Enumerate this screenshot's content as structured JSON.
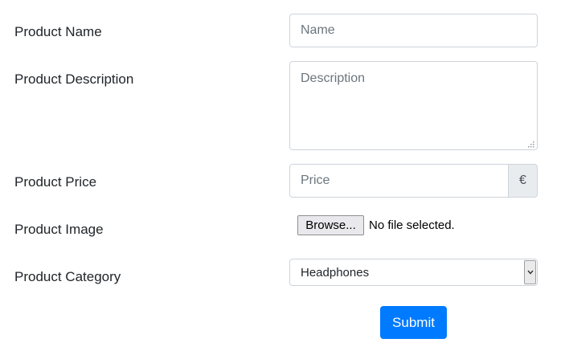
{
  "form": {
    "name": {
      "label": "Product Name",
      "placeholder": "Name"
    },
    "description": {
      "label": "Product Description",
      "placeholder": "Description"
    },
    "price": {
      "label": "Product Price",
      "placeholder": "Price",
      "currency_symbol": "€"
    },
    "image": {
      "label": "Product Image",
      "browse_label": "Browse...",
      "file_status": "No file selected."
    },
    "category": {
      "label": "Product Category",
      "selected": "Headphones",
      "arrow_icon": "chevron-down-icon"
    },
    "submit_label": "Submit"
  },
  "colors": {
    "primary": "#007bff",
    "border": "#ced4da",
    "addon_background": "#e9ecef",
    "placeholder": "#6c757d"
  }
}
